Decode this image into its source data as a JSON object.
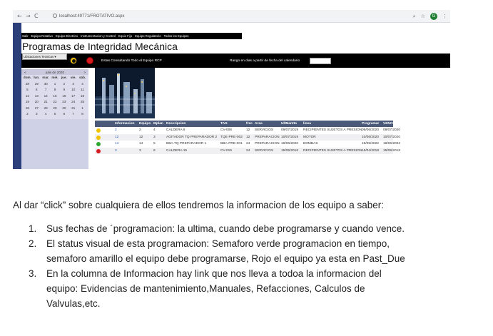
{
  "browser": {
    "back": "←",
    "forward": "→",
    "reload": "C",
    "url": "localhost:49771/FROTATIVO.aspx",
    "zoom_icon": "⌕",
    "star_icon": "☆",
    "profile_initial": "G",
    "menu_icon": "⋮"
  },
  "app": {
    "menu": [
      "Salir",
      "Equipo Rotativo",
      "Equipo Electrico",
      "Instrumentacion y Control",
      "Equio Fijo",
      "Equipo Regulatorio",
      "Todos los Equipos"
    ],
    "title": "Programas de Integridad Mecánica",
    "select_value": "Ubicaciones Tecnicas",
    "status_text": "Estas Consultando Todo el Equipo RCP",
    "range_label": "Rango en dias a partir de fecha del calendario",
    "calendar": {
      "prev": "<",
      "month": "julio de 2020",
      "next": ">",
      "weekdays": [
        "dom.",
        "lun.",
        "mar.",
        "mié.",
        "jue.",
        "vie.",
        "sáb."
      ],
      "days": [
        "28",
        "29",
        "30",
        "1",
        "2",
        "3",
        "4",
        "5",
        "6",
        "7",
        "8",
        "9",
        "10",
        "11",
        "12",
        "13",
        "14",
        "15",
        "16",
        "17",
        "18",
        "19",
        "20",
        "21",
        "22",
        "23",
        "24",
        "25",
        "26",
        "27",
        "28",
        "29",
        "30",
        "31",
        "1",
        "2",
        "3",
        "4",
        "5",
        "6",
        "7",
        "8"
      ]
    },
    "table": {
      "headers": [
        "Informacion",
        "Equipo",
        "Mplan",
        "Descripcion",
        "TAG",
        "frec",
        "Area",
        "UltMantto",
        "linea",
        "Programar",
        "VENCE"
      ],
      "rows": [
        {
          "status": "yellow",
          "status_color": "#f2c300",
          "info": "2",
          "equipo": "2",
          "mplan": "4",
          "desc": "CALDERA 6",
          "tag": "CV-006",
          "frec": "12",
          "area": "SERVICIOS",
          "ult": "09/07/2019",
          "linea": "RECIPIENTES SUJETOS A PRESION",
          "prog": "09/06/2020",
          "vence": "09/07/2020"
        },
        {
          "status": "yellow",
          "status_color": "#f2c300",
          "info": "12",
          "equipo": "12",
          "mplan": "3",
          "desc": "AGITADOR TQ PREPARADOR 2",
          "tag": "TQE-PRE-002",
          "frec": "12",
          "area": "PREPARACION",
          "ult": "10/07/2019",
          "linea": "MOTOR",
          "prog": "10/06/2020",
          "vence": "10/07/2020"
        },
        {
          "status": "green",
          "status_color": "#2fa82f",
          "info": "14",
          "equipo": "14",
          "mplan": "5",
          "desc": "BBA.TQ PREPARADOR 1",
          "tag": "BBA-PRE-001",
          "frec": "24",
          "area": "PREPARACION",
          "ult": "19/06/2020",
          "linea": "BOMBAS",
          "prog": "19/05/2022",
          "vence": "19/06/2022"
        },
        {
          "status": "red",
          "status_color": "#d71920",
          "info": "3",
          "equipo": "3",
          "mplan": "6",
          "desc": "CALDERA 15",
          "tag": "CV-015",
          "frec": "24",
          "area": "SERVICIOS",
          "ult": "15/05/2016",
          "linea": "RECIPIENTES SUJETOS A PRESION",
          "prog": "15/04/2018",
          "vence": "15/05/2018"
        }
      ]
    }
  },
  "doc": {
    "intro": "Al dar “click” sobre cualquiera de ellos tendremos la informacion de los equipo a saber:",
    "items": [
      {
        "num": "1.",
        "lines": [
          "Sus fechas de ´programacion: la ultima, cuando debe programarse y cuando vence."
        ]
      },
      {
        "num": "2.",
        "lines": [
          "El status visual de esta programacion: Semaforo verde programacion en tiempo,",
          "semaforo amarillo el equipo debe programarse, Rojo el equipo  ya esta en Past_Due"
        ]
      },
      {
        "num": "3.",
        "lines": [
          "En la columna de Informacion hay link que nos lleva a todoa la informacion del",
          "equipo: Evidencias de mantenimiento,Manuales, Refacciones, Calculos de",
          "Valvulas,etc."
        ]
      }
    ]
  }
}
